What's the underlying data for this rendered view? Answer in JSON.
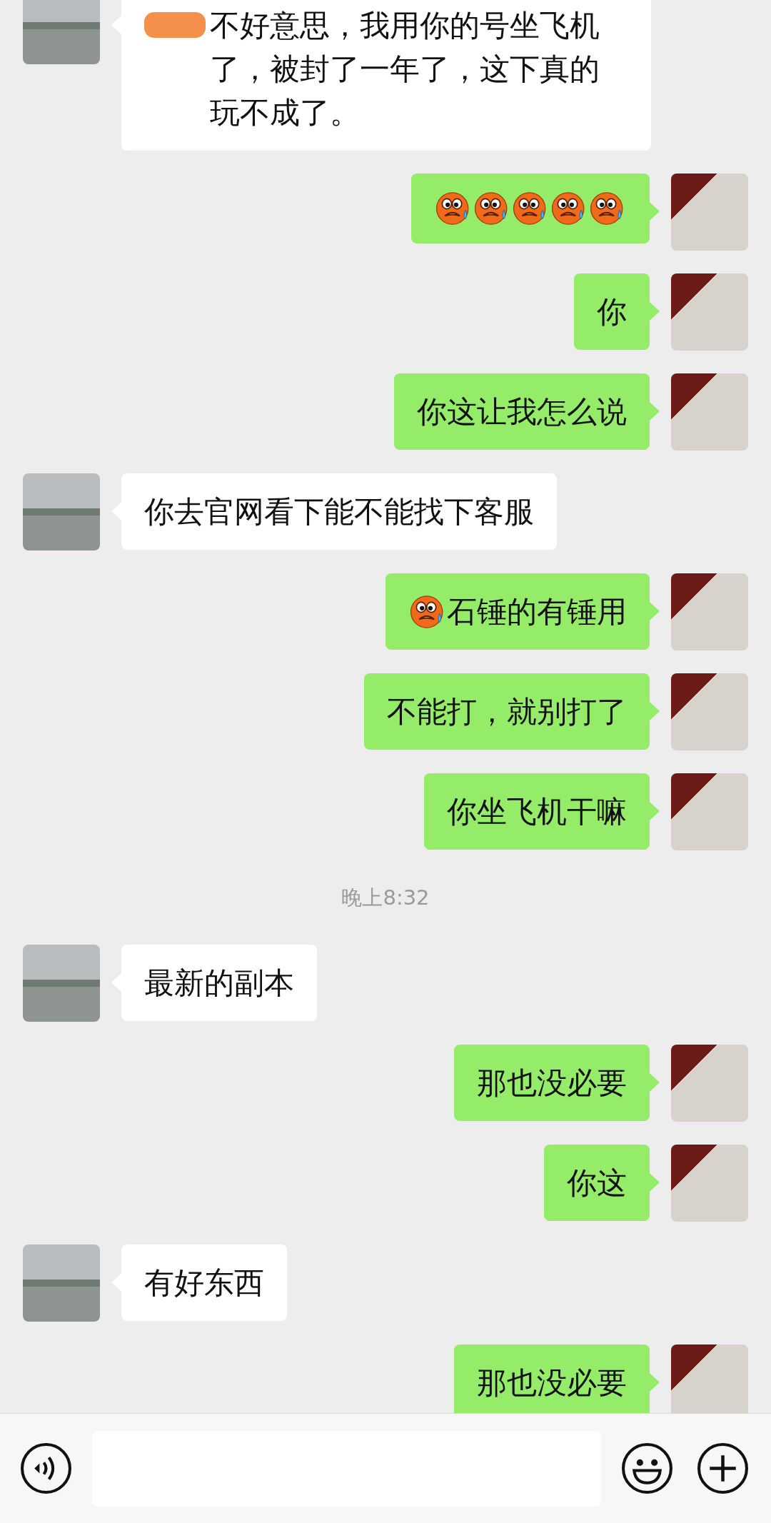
{
  "messages": [
    {
      "kind": "message",
      "outgoing": false,
      "parts": [
        {
          "kind": "redacted"
        },
        {
          "kind": "text",
          "text": "不好意思，我用你的号坐飞机了，被封了一年了，这下真的玩不成了。"
        }
      ]
    },
    {
      "kind": "message",
      "outgoing": true,
      "parts": [
        {
          "kind": "emoji"
        },
        {
          "kind": "emoji"
        },
        {
          "kind": "emoji"
        },
        {
          "kind": "emoji"
        },
        {
          "kind": "emoji"
        }
      ]
    },
    {
      "kind": "message",
      "outgoing": true,
      "parts": [
        {
          "kind": "text",
          "text": "你"
        }
      ]
    },
    {
      "kind": "message",
      "outgoing": true,
      "parts": [
        {
          "kind": "text",
          "text": "你这让我怎么说"
        }
      ]
    },
    {
      "kind": "message",
      "outgoing": false,
      "parts": [
        {
          "kind": "text",
          "text": "你去官网看下能不能找下客服"
        }
      ]
    },
    {
      "kind": "message",
      "outgoing": true,
      "parts": [
        {
          "kind": "emoji"
        },
        {
          "kind": "text",
          "text": "石锤的有锤用"
        }
      ]
    },
    {
      "kind": "message",
      "outgoing": true,
      "parts": [
        {
          "kind": "text",
          "text": "不能打，就别打了"
        }
      ]
    },
    {
      "kind": "message",
      "outgoing": true,
      "parts": [
        {
          "kind": "text",
          "text": "你坐飞机干嘛"
        }
      ]
    },
    {
      "kind": "time",
      "text": "晚上8:32"
    },
    {
      "kind": "message",
      "outgoing": false,
      "parts": [
        {
          "kind": "text",
          "text": "最新的副本"
        }
      ]
    },
    {
      "kind": "message",
      "outgoing": true,
      "parts": [
        {
          "kind": "text",
          "text": "那也没必要"
        }
      ]
    },
    {
      "kind": "message",
      "outgoing": true,
      "parts": [
        {
          "kind": "text",
          "text": "你这"
        }
      ]
    },
    {
      "kind": "message",
      "outgoing": false,
      "parts": [
        {
          "kind": "text",
          "text": "有好东西"
        }
      ]
    },
    {
      "kind": "message",
      "outgoing": true,
      "parts": [
        {
          "kind": "text",
          "text": "那也没必要"
        }
      ]
    }
  ]
}
